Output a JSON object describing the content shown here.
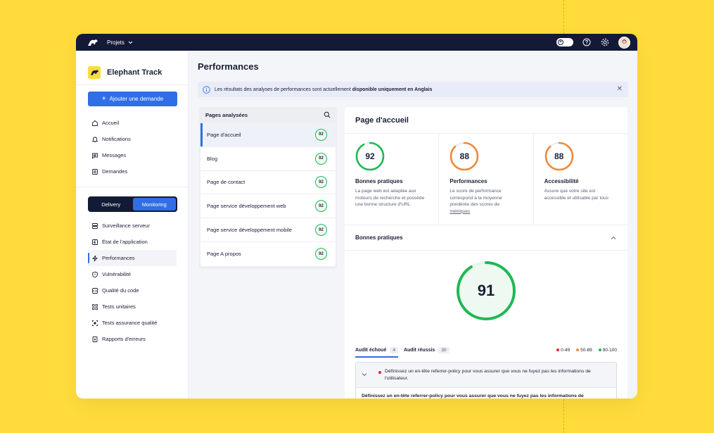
{
  "topbar": {
    "projects_label": "Projets"
  },
  "brand": {
    "name": "Elephant Track"
  },
  "sidebar": {
    "add_button": "Ajouter une demande",
    "top_nav": [
      {
        "label": "Accueil"
      },
      {
        "label": "Notifications"
      },
      {
        "label": "Messages"
      },
      {
        "label": "Demandes"
      }
    ],
    "segment": {
      "delivery": "Delivery",
      "monitoring": "Monitoring"
    },
    "monitoring_nav": [
      {
        "label": "Surveillance serveur"
      },
      {
        "label": "État de l'application"
      },
      {
        "label": "Performances"
      },
      {
        "label": "Vulnérabilité"
      },
      {
        "label": "Qualité du code"
      },
      {
        "label": "Tests unitaires"
      },
      {
        "label": "Tests assurance qualité"
      },
      {
        "label": "Rapports d'erreurs"
      }
    ]
  },
  "main": {
    "title": "Performances",
    "banner": {
      "text": "Les résultats des analyses de performances sont actuellement ",
      "bold": "disponible uniquement en Anglais"
    }
  },
  "pages": {
    "header": "Pages analysées",
    "items": [
      {
        "label": "Page d'accueil",
        "score": "92"
      },
      {
        "label": "Blog",
        "score": "92"
      },
      {
        "label": "Page de contact",
        "score": "92"
      },
      {
        "label": "Page service développement web",
        "score": "92"
      },
      {
        "label": "Page service développement mobile",
        "score": "92"
      },
      {
        "label": "Page A propos",
        "score": "92"
      }
    ]
  },
  "detail": {
    "title": "Page d'accueil",
    "metrics": [
      {
        "score": "92",
        "value": 0.92,
        "color": "#1fb854",
        "name": "Bonnes pratiques",
        "desc": "La page web est adaptée aux moteurs de recherche et possède une bonne structure d'URL"
      },
      {
        "score": "88",
        "value": 0.88,
        "color": "#f0893c",
        "name": "Performances",
        "desc": "Le score de performance correspond à la moyenne pondérée des scores de ",
        "desc_link": "métriques"
      },
      {
        "score": "88",
        "value": 0.88,
        "color": "#f0893c",
        "name": "Accessibilité",
        "desc": "Assure que votre site est accessible et utilisable par tous"
      }
    ],
    "section_title": "Bonnes pratiques",
    "big_score": "91",
    "big_value": 0.91,
    "tabs": [
      {
        "label": "Audit échoué",
        "count": "4"
      },
      {
        "label": "Audit réussis",
        "count": "30"
      }
    ],
    "legend": [
      {
        "label": "0-49",
        "color": "#e0243f"
      },
      {
        "label": "50-89",
        "color": "#f0893c"
      },
      {
        "label": "90-100",
        "color": "#1fb854"
      }
    ],
    "audit": {
      "head": "Définissez un en-tête referrer-policy pour vous assurer que vous ne fuyez pas les informations de l'utilisateur.",
      "body": "Définissez un en-tête referrer-policy pour vous assurer que vous ne fuyez pas les informations de"
    }
  }
}
